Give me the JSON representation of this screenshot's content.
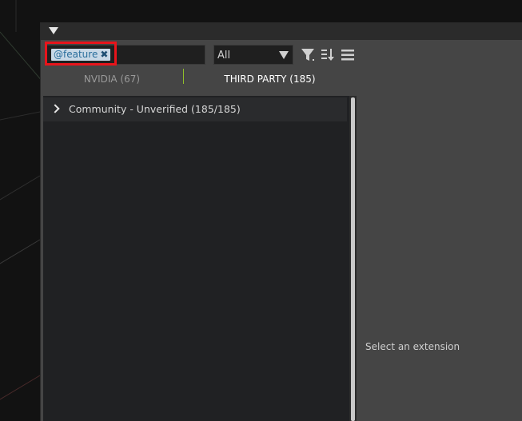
{
  "window": {
    "title": ""
  },
  "search": {
    "tag_label": "@feature",
    "tag_close": "✖",
    "value": ""
  },
  "filter_dropdown": {
    "selected": "All"
  },
  "toolbar": {
    "icons": [
      "filter-icon",
      "sort-icon",
      "menu-icon"
    ]
  },
  "tabs": [
    {
      "label": "NVIDIA (67)",
      "active": false
    },
    {
      "label": "THIRD PARTY (185)",
      "active": true
    }
  ],
  "list": {
    "groups": [
      {
        "label": "Community - Unverified (185/185)",
        "expanded": false
      }
    ]
  },
  "detail": {
    "placeholder": "Select an extension"
  },
  "colors": {
    "highlight": "#e8141b",
    "tab_accent": "#8fbf2a",
    "tag_bg": "#c8d8e6",
    "tag_text": "#2a6e9c"
  }
}
